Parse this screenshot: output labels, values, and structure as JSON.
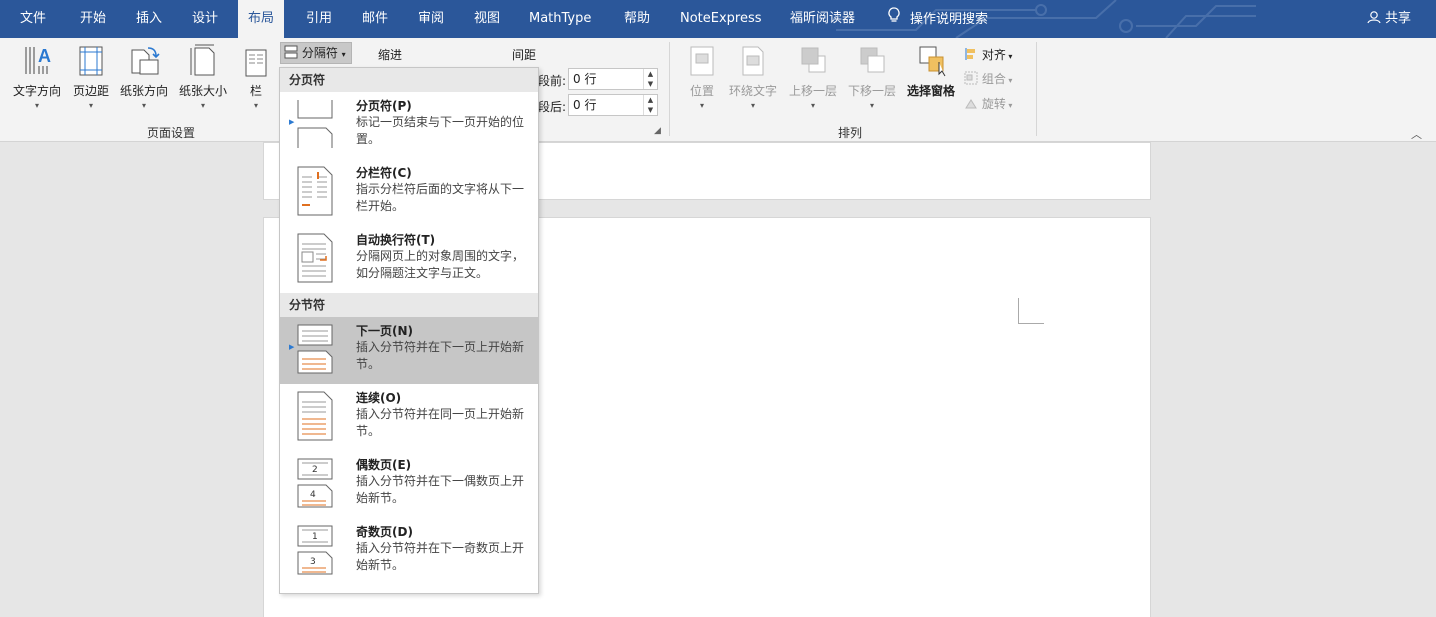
{
  "tabs": [
    {
      "label": "文件",
      "active": false
    },
    {
      "label": "开始",
      "active": false
    },
    {
      "label": "插入",
      "active": false
    },
    {
      "label": "设计",
      "active": false
    },
    {
      "label": "布局",
      "active": true
    },
    {
      "label": "引用",
      "active": false
    },
    {
      "label": "邮件",
      "active": false
    },
    {
      "label": "审阅",
      "active": false
    },
    {
      "label": "视图",
      "active": false
    },
    {
      "label": "MathType",
      "active": false
    },
    {
      "label": "帮助",
      "active": false
    },
    {
      "label": "NoteExpress",
      "active": false
    },
    {
      "label": "福昕阅读器",
      "active": false
    }
  ],
  "tell_me": "操作说明搜索",
  "share": "共享",
  "ribbon": {
    "page_setup": {
      "text_direction": "文字方向",
      "margins": "页边距",
      "orientation": "纸张方向",
      "size": "纸张大小",
      "columns": "栏",
      "group_label": "页面设置"
    },
    "breaks_button": "分隔符",
    "indent_label": "缩进",
    "spacing_label": "间距",
    "before_label": "段前:",
    "before_value": "0 行",
    "after_label": "段后:",
    "after_value": "0 行",
    "arrange": {
      "position": "位置",
      "wrap_text": "环绕文字",
      "bring_forward": "上移一层",
      "send_backward": "下移一层",
      "selection_pane": "选择窗格",
      "align": "对齐",
      "group": "组合",
      "rotate": "旋转",
      "group_label": "排列"
    }
  },
  "breaks_menu": {
    "page_breaks_header": "分页符",
    "section_breaks_header": "分节符",
    "page_items": [
      {
        "title": "分页符(P)",
        "desc": "标记一页结束与下一页开始的位置。",
        "icon": "page-break-icon"
      },
      {
        "title": "分栏符(C)",
        "desc": "指示分栏符后面的文字将从下一栏开始。",
        "icon": "column-break-icon"
      },
      {
        "title": "自动换行符(T)",
        "desc": "分隔网页上的对象周围的文字，如分隔题注文字与正文。",
        "icon": "text-wrapping-icon"
      }
    ],
    "section_items": [
      {
        "title": "下一页(N)",
        "desc": "插入分节符并在下一页上开始新节。",
        "icon": "next-page-icon",
        "selected": true
      },
      {
        "title": "连续(O)",
        "desc": "插入分节符并在同一页上开始新节。",
        "icon": "continuous-icon"
      },
      {
        "title": "偶数页(E)",
        "desc": "插入分节符并在下一偶数页上开始新节。",
        "icon": "even-page-icon"
      },
      {
        "title": "奇数页(D)",
        "desc": "插入分节符并在下一奇数页上开始新节。",
        "icon": "odd-page-icon"
      }
    ]
  },
  "colors": {
    "accent": "#2b579a",
    "ribbon_bg": "#f3f3f3",
    "selected_item": "#c6c6c6"
  }
}
